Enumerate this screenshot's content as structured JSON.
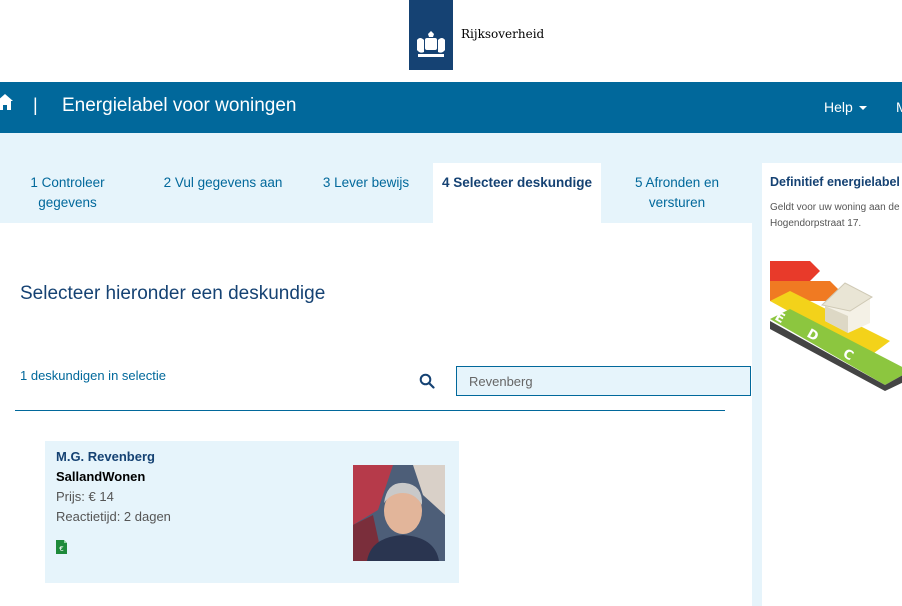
{
  "brand": {
    "logo_text": "Rijksoverheid",
    "color": "#154273"
  },
  "header": {
    "title": "Energielabel voor woningen",
    "separator": "|",
    "help_label": "Help",
    "menu_label": "M",
    "bg_color": "#01689b"
  },
  "steps": [
    {
      "label": "1 Controleer gegevens",
      "active": false
    },
    {
      "label": "2 Vul gegevens aan",
      "active": false
    },
    {
      "label": "3 Lever bewijs",
      "active": false
    },
    {
      "label": "4 Selecteer deskundige",
      "active": true
    },
    {
      "label": "5 Afronden en versturen",
      "active": false
    }
  ],
  "main": {
    "heading": "Selecteer hieronder een deskundige",
    "count_text": "1 deskundigen in selectie",
    "search": {
      "value": "Revenberg",
      "icon": "search-icon"
    }
  },
  "expert": {
    "name": "M.G. Revenberg",
    "company": "SallandWonen",
    "price": "Prijs: € 14",
    "reaction_time": "Reactietijd: 2 dagen",
    "file_icon": "spreadsheet-euro-icon"
  },
  "sidebar": {
    "title": "Definitief energielabel",
    "text_line1": "Geldt voor uw woning aan de",
    "text_line2": "Hogendorpstraat 17.",
    "label_letters": [
      "E",
      "D",
      "C"
    ]
  }
}
